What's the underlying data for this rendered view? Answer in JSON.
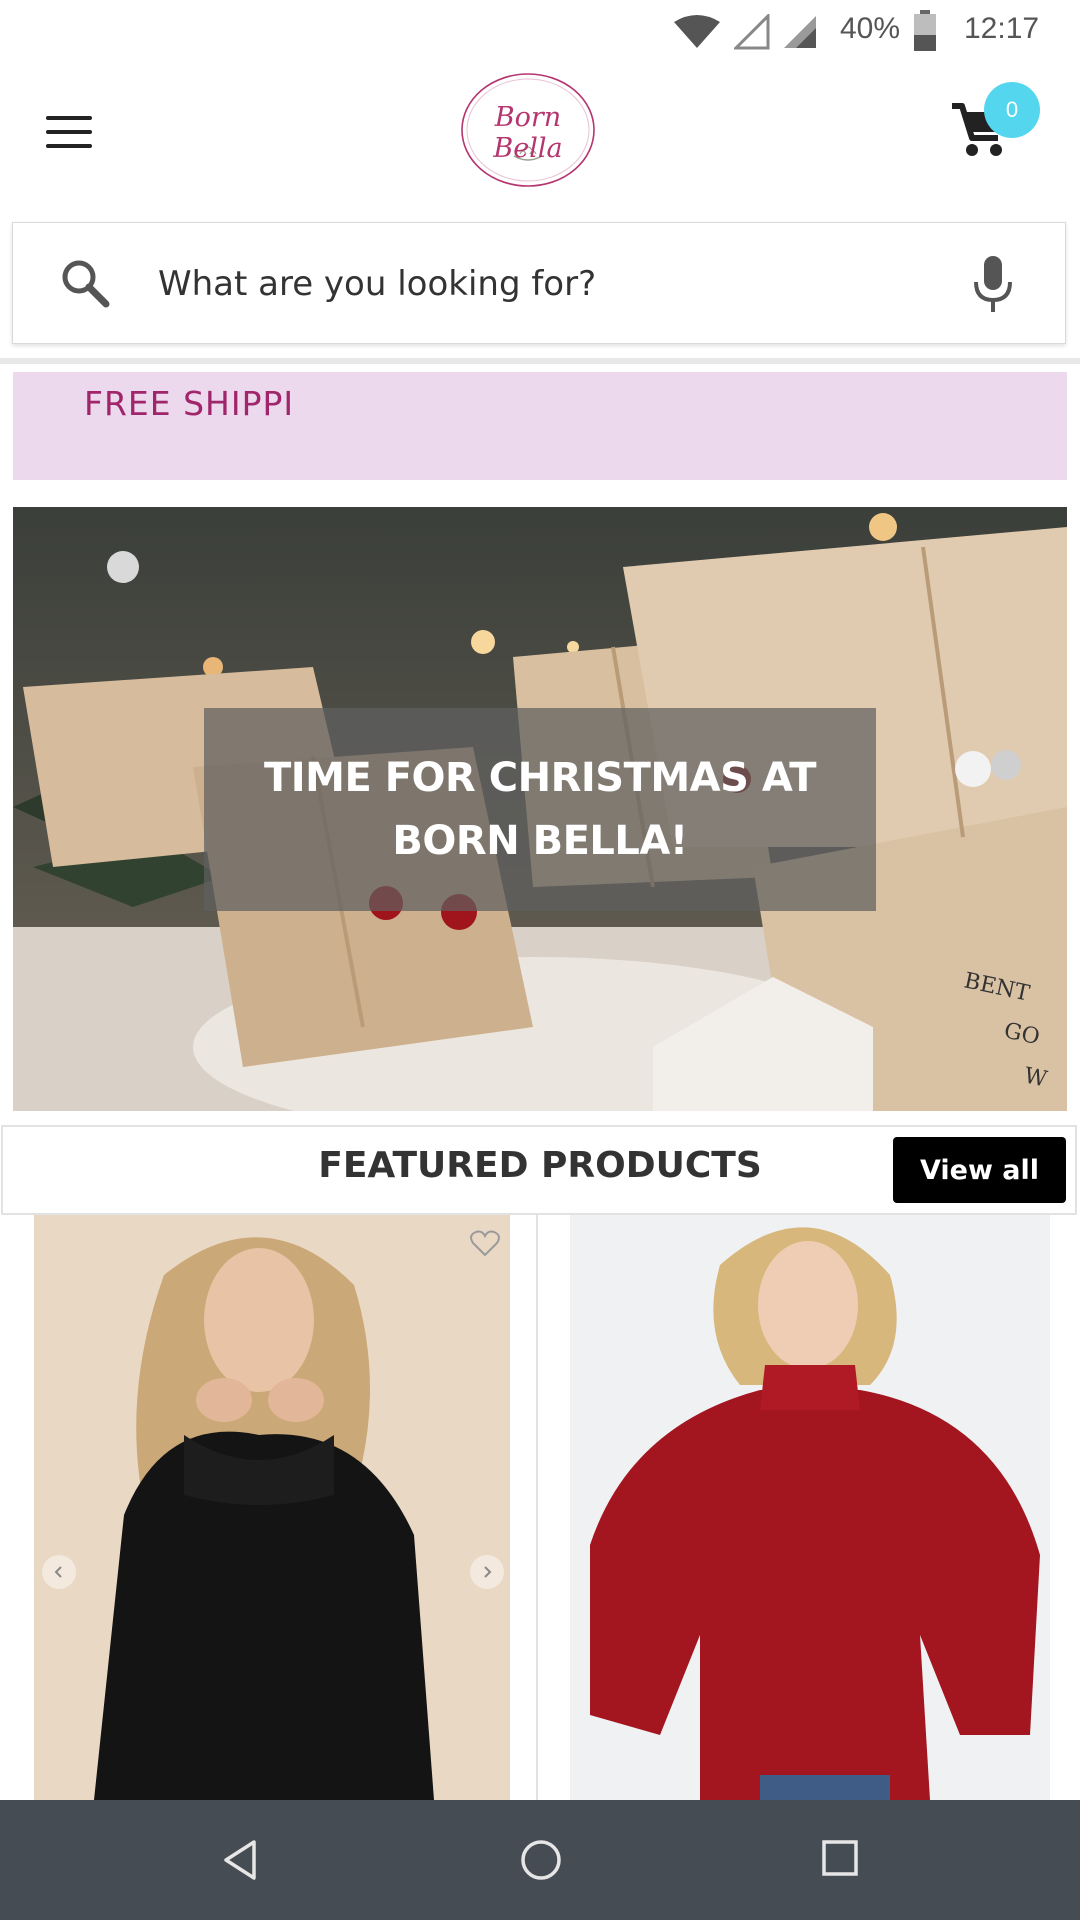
{
  "status_bar": {
    "battery": "40%",
    "time": "12:17",
    "icons": [
      "wifi-icon",
      "signal-empty-icon",
      "signal-icon",
      "battery-icon"
    ]
  },
  "header": {
    "logo_text": "Born Bella",
    "cart_count": "0",
    "icons": [
      "menu-icon",
      "cart-icon"
    ]
  },
  "search": {
    "placeholder": "What are you looking for?",
    "icons": [
      "search-icon",
      "mic-icon"
    ]
  },
  "promo": {
    "text": "FREE SHIPPI"
  },
  "hero": {
    "title": "TIME FOR CHRISTMAS AT BORN BELLA!"
  },
  "featured": {
    "title": "FEATURED PRODUCTS",
    "view_all": "View all"
  },
  "products": [
    {
      "image": "black-sweater-photo",
      "icons": [
        "heart-icon",
        "chevron-left-icon",
        "chevron-right-icon"
      ]
    },
    {
      "image": "red-sweater-photo"
    }
  ],
  "nav": {
    "icons": [
      "back-icon",
      "home-icon",
      "recents-icon"
    ]
  },
  "colors": {
    "accent": "#55d6ef",
    "promo_bg": "#ecd9ee",
    "promo_text": "#a0256a",
    "logo": "#b5356f",
    "nav_bg": "#464c54"
  }
}
